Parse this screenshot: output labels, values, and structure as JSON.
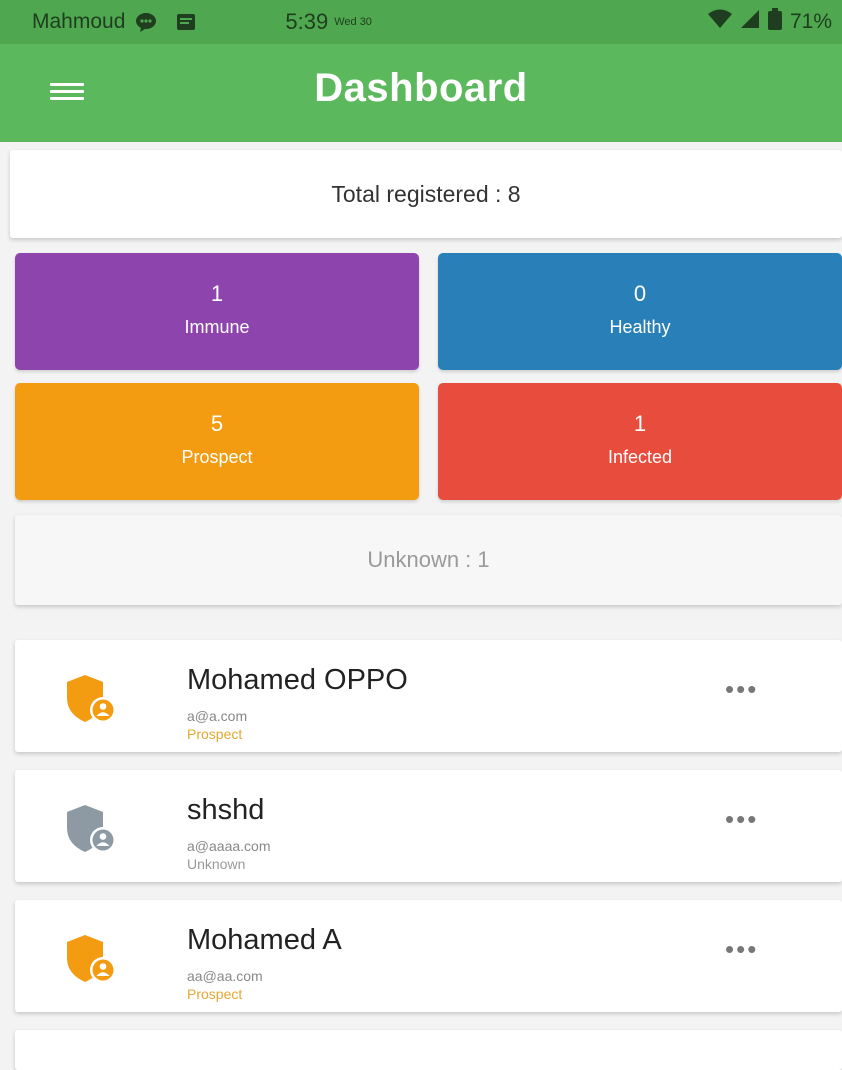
{
  "status_bar": {
    "owner": "Mahmoud",
    "time": "5:39",
    "date": "Wed 30",
    "battery": "71%",
    "icons": [
      "messenger-icon",
      "message-icon",
      "wifi-icon",
      "signal-icon",
      "battery-icon"
    ]
  },
  "app_bar": {
    "title": "Dashboard",
    "menu_icon": "hamburger-menu-icon"
  },
  "summary": {
    "total_label": "Total registered : 8"
  },
  "stats": {
    "immune": {
      "count": "1",
      "label": "Immune",
      "color": "#8e44ad"
    },
    "healthy": {
      "count": "0",
      "label": "Healthy",
      "color": "#2980b9"
    },
    "prospect": {
      "count": "5",
      "label": "Prospect",
      "color": "#f39c12"
    },
    "infected": {
      "count": "1",
      "label": "Infected",
      "color": "#e74c3c"
    }
  },
  "unknown_label": "Unknown : 1",
  "users": [
    {
      "name": "Mohamed OPPO",
      "email": "a@a.com",
      "status": "Prospect",
      "status_color": "#e3a833",
      "icon": "shield-user-icon",
      "icon_color": "#f39c12",
      "more": "•••"
    },
    {
      "name": "shshd",
      "email": "a@aaaa.com",
      "status": "Unknown",
      "status_color": "#999999",
      "icon": "shield-user-icon",
      "icon_color": "#8d9aa3",
      "more": "•••"
    },
    {
      "name": "Mohamed A",
      "email": "aa@aa.com",
      "status": "Prospect",
      "status_color": "#e3a833",
      "icon": "shield-user-icon",
      "icon_color": "#f39c12",
      "more": "•••"
    }
  ],
  "colors": {
    "status_bar": "#4fa84f",
    "app_bar": "#5cb85c",
    "background": "#f3f3f3"
  }
}
